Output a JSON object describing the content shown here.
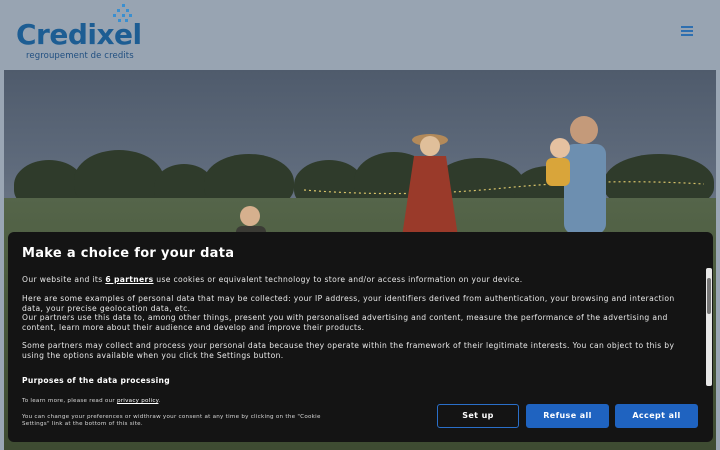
{
  "header": {
    "logo_text_a": "Credi",
    "logo_text_b": "xel",
    "logo_tagline": "regroupement de credits",
    "brand_color": "#1d5d93",
    "menu_icon": "hamburger-icon"
  },
  "dialog": {
    "title": "Make a choice for your data",
    "intro_before": "Our website and its ",
    "intro_link": "6 partners",
    "intro_after": " use cookies or equivalent technology to store and/or access information on your device.",
    "para2": "Here are some examples of personal data that may be collected: your IP address, your identifiers derived from authentication, your browsing and interaction data, your precise geolocation data, etc.",
    "para3": "Our partners use this data to, among other things, present you with personalised advertising and content, measure the performance of the advertising and content, learn more about their audience and develop and improve their products.",
    "para4": "Some partners may collect and process your personal data because they operate within the framework of their legitimate interests. You can object to this by using the options available when you click the Settings button.",
    "purposes_heading": "Purposes of the data processing",
    "learn_more_before": "To learn more, please read our ",
    "learn_more_link": "privacy policy",
    "learn_more_after": ".",
    "change_prefs": "You can change your preferences or widthraw your consent at any time by clicking on the \"Cookie Settings\" link at the bottom of this site.",
    "buttons": {
      "setup": "Set up",
      "refuse": "Refuse all",
      "accept": "Accept all"
    },
    "accent_color": "#1f63c0"
  }
}
